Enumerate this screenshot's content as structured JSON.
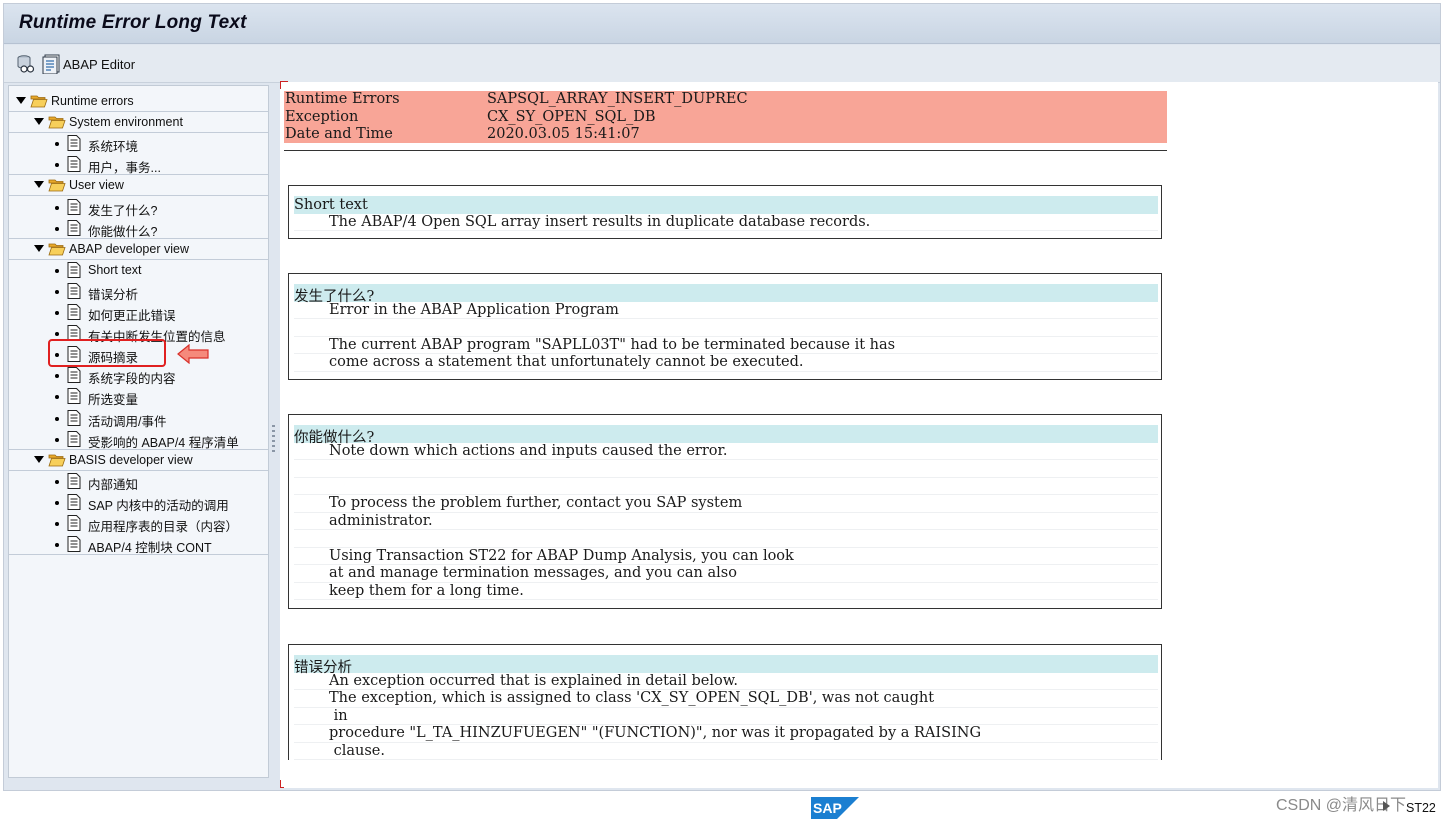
{
  "window": {
    "title": "Runtime Error Long Text"
  },
  "toolbar": {
    "abap_editor_label": "ABAP Editor"
  },
  "tree": {
    "items": [
      {
        "level": 0,
        "type": "folder",
        "label": "Runtime errors"
      },
      {
        "level": 1,
        "type": "folder",
        "label": "System environment"
      },
      {
        "level": 2,
        "type": "doc",
        "label": "系统环境"
      },
      {
        "level": 2,
        "type": "doc",
        "label": "用户，事务..."
      },
      {
        "level": 1,
        "type": "folder",
        "label": "User view"
      },
      {
        "level": 2,
        "type": "doc",
        "label": "发生了什么?"
      },
      {
        "level": 2,
        "type": "doc",
        "label": "你能做什么?"
      },
      {
        "level": 1,
        "type": "folder",
        "label": "ABAP developer view"
      },
      {
        "level": 2,
        "type": "doc",
        "label": "Short text"
      },
      {
        "level": 2,
        "type": "doc",
        "label": "错误分析"
      },
      {
        "level": 2,
        "type": "doc",
        "label": "如何更正此错误"
      },
      {
        "level": 2,
        "type": "doc",
        "label": "有关中断发生位置的信息"
      },
      {
        "level": 2,
        "type": "doc",
        "label": "源码摘录",
        "highlighted": true
      },
      {
        "level": 2,
        "type": "doc",
        "label": "系统字段的内容"
      },
      {
        "level": 2,
        "type": "doc",
        "label": "所选变量"
      },
      {
        "level": 2,
        "type": "doc",
        "label": "活动调用/事件"
      },
      {
        "level": 2,
        "type": "doc",
        "label": "受影响的 ABAP/4 程序清单"
      },
      {
        "level": 1,
        "type": "folder",
        "label": "BASIS developer view"
      },
      {
        "level": 2,
        "type": "doc",
        "label": "内部通知"
      },
      {
        "level": 2,
        "type": "doc",
        "label": "SAP 内核中的活动的调用"
      },
      {
        "level": 2,
        "type": "doc",
        "label": "应用程序表的目录（内容）"
      },
      {
        "level": 2,
        "type": "doc",
        "label": "ABAP/4 控制块 CONT"
      }
    ]
  },
  "header": {
    "rows": [
      {
        "key": "Runtime Errors",
        "value": "SAPSQL_ARRAY_INSERT_DUPREC"
      },
      {
        "key": "Exception",
        "value": "CX_SY_OPEN_SQL_DB"
      },
      {
        "key": "Date and Time",
        "value": "2020.03.05 15:41:07"
      }
    ]
  },
  "sections": [
    {
      "title": "Short text",
      "lines": [
        "The ABAP/4 Open SQL array insert results in duplicate database records."
      ]
    },
    {
      "title": "发生了什么?",
      "lines": [
        "Error in the ABAP Application Program",
        "",
        "The current ABAP program \"SAPLL03T\" had to be terminated because it has",
        "come across a statement that unfortunately cannot be executed."
      ]
    },
    {
      "title": "你能做什么?",
      "lines": [
        "Note down which actions and inputs caused the error.",
        "",
        "",
        "To process the problem further, contact you SAP system",
        "administrator.",
        "",
        "Using Transaction ST22 for ABAP Dump Analysis, you can look",
        "at and manage termination messages, and you can also",
        "keep them for a long time."
      ]
    },
    {
      "title": "错误分析",
      "lines": [
        "An exception occurred that is explained in detail below.",
        "The exception, which is assigned to class 'CX_SY_OPEN_SQL_DB', was not caught",
        " in",
        "procedure \"L_TA_HINZUFUEGEN\" \"(FUNCTION)\", nor was it propagated by a RAISING",
        " clause."
      ]
    }
  ],
  "status": {
    "transaction": "ST22",
    "watermark": "CSDN @清风日下"
  },
  "colors": {
    "header_bg": "#f8a597",
    "section_title_bg": "#cdebee",
    "highlight_border": "#e02020"
  }
}
